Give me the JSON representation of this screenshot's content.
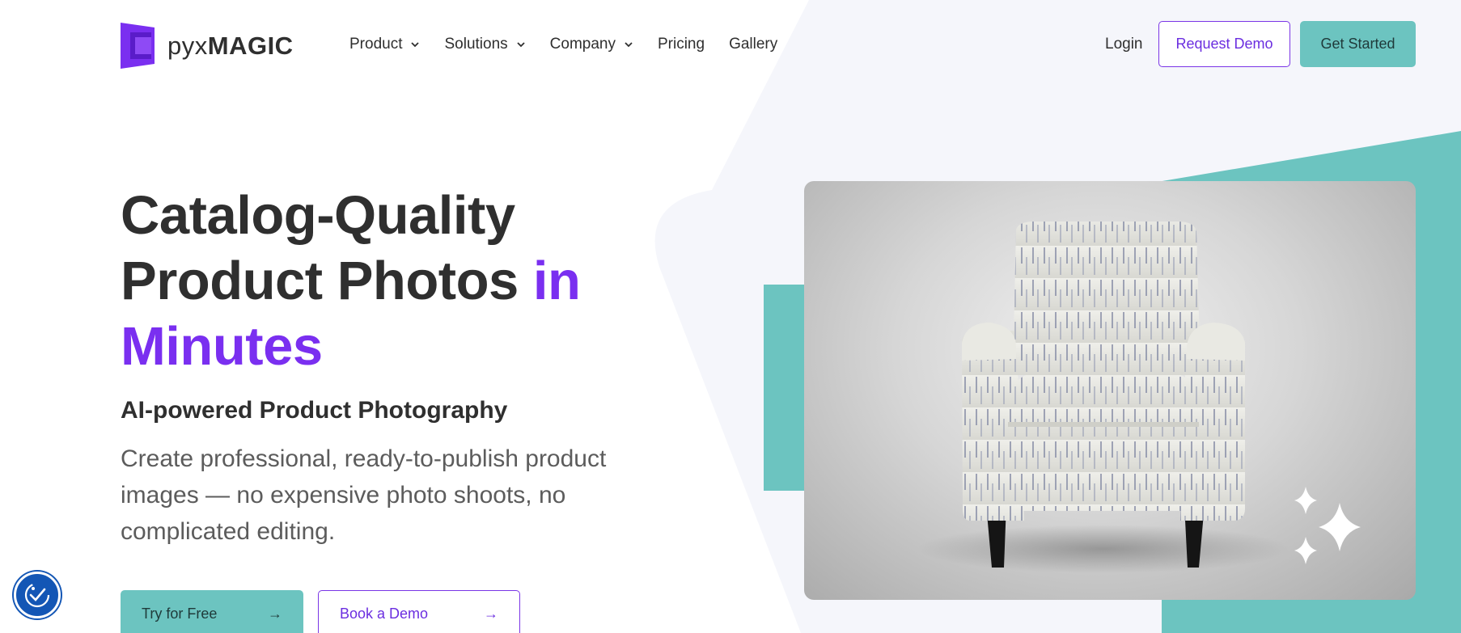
{
  "brand": {
    "name_light": "pyx",
    "name_bold": "MAGIC",
    "color": "#7a2ff0"
  },
  "nav": {
    "items": [
      {
        "label": "Product",
        "dropdown": true
      },
      {
        "label": "Solutions",
        "dropdown": true
      },
      {
        "label": "Company",
        "dropdown": true
      },
      {
        "label": "Pricing",
        "dropdown": false
      },
      {
        "label": "Gallery",
        "dropdown": false
      }
    ],
    "login": "Login",
    "request_demo": "Request Demo",
    "get_started": "Get Started"
  },
  "hero": {
    "title_line1": "Catalog-Quality",
    "title_line2": "Product Photos ",
    "title_accent_a": "in",
    "title_accent_b": "Minutes",
    "subtitle": "AI-powered Product Photography",
    "description": "Create professional, ready-to-publish product images — no expensive photo shoots, no complicated editing.",
    "cta_primary": "Try for Free",
    "cta_secondary": "Book a Demo",
    "arrow": "→"
  },
  "colors": {
    "accent": "#7a2ff0",
    "teal": "#6cc4c0",
    "text": "#2f2f2f",
    "a11y": "#1356b5"
  },
  "icons": {
    "chevron": "chevron-down-icon",
    "sparkle": "sparkle-icon",
    "accessibility": "accessibility-icon",
    "arrow": "arrow-right-icon"
  }
}
